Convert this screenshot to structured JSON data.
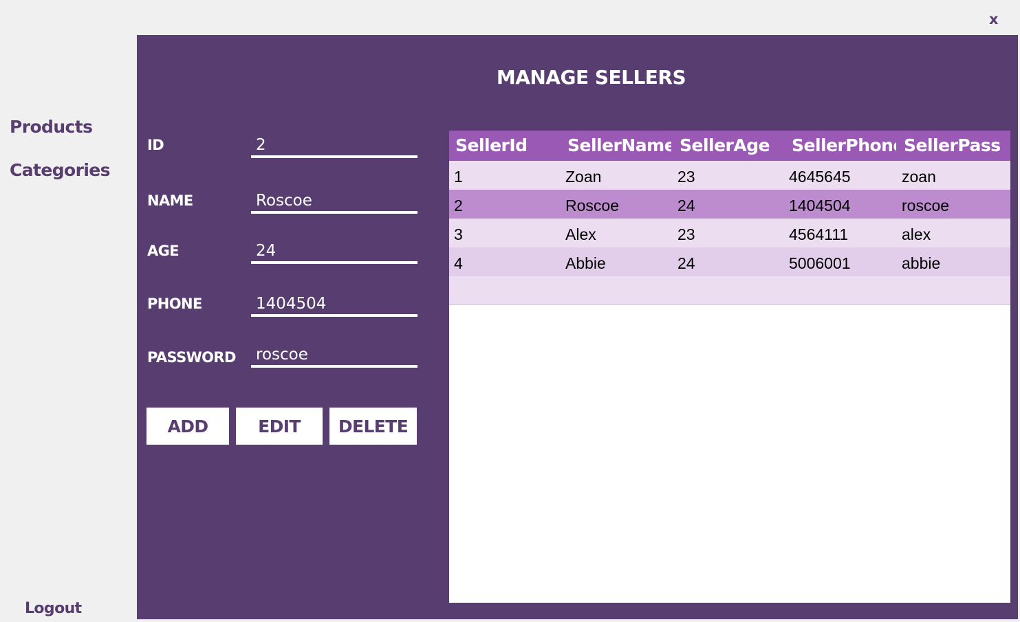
{
  "window": {
    "close_label": "x"
  },
  "sidebar": {
    "products": "Products",
    "categories": "Categories",
    "logout": "Logout"
  },
  "panel": {
    "title": "MANAGE SELLERS"
  },
  "form": {
    "id_label": "ID",
    "id_value": "2",
    "name_label": "NAME",
    "name_value": "Roscoe",
    "age_label": "AGE",
    "age_value": "24",
    "phone_label": "PHONE",
    "phone_value": "1404504",
    "password_label": "PASSWORD",
    "password_value": "roscoe"
  },
  "buttons": {
    "add": "ADD",
    "edit": "EDIT",
    "delete": "DELETE"
  },
  "grid": {
    "columns": [
      "SellerId",
      "SellerName",
      "SellerAge",
      "SellerPhone",
      "SellerPass"
    ],
    "rows": [
      [
        "1",
        "Zoan",
        "23",
        "4645645",
        "zoan"
      ],
      [
        "2",
        "Roscoe",
        "24",
        "1404504",
        "roscoe"
      ],
      [
        "3",
        "Alex",
        "23",
        "4564111",
        "alex"
      ],
      [
        "4",
        "Abbie",
        "24",
        "5006001",
        "abbie"
      ]
    ],
    "selected_row": 1
  },
  "colors": {
    "panel_background": "#583d70",
    "grid_header": "#9b59b6",
    "row_selected": "#bd8cce",
    "row_light": "#ecdef0",
    "row_alt": "#e2cdea",
    "sidebar_text": "#573e6f"
  }
}
